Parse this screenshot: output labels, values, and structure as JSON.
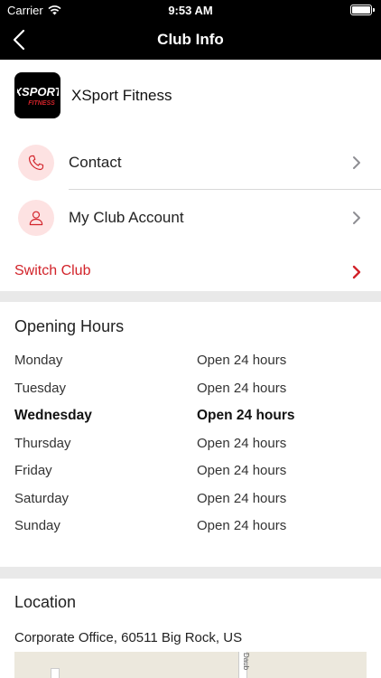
{
  "status": {
    "carrier": "Carrier",
    "time": "9:53 AM"
  },
  "nav": {
    "title": "Club Info"
  },
  "club": {
    "name": "XSport Fitness",
    "contact_label": "Contact",
    "account_label": "My Club Account",
    "switch_label": "Switch Club"
  },
  "hours": {
    "title": "Opening Hours",
    "rows": [
      {
        "day": "Monday",
        "value": "Open 24 hours"
      },
      {
        "day": "Tuesday",
        "value": "Open 24 hours"
      },
      {
        "day": "Wednesday",
        "value": "Open 24 hours"
      },
      {
        "day": "Thursday",
        "value": "Open 24 hours"
      },
      {
        "day": "Friday",
        "value": "Open 24 hours"
      },
      {
        "day": "Saturday",
        "value": "Open 24 hours"
      },
      {
        "day": "Sunday",
        "value": "Open 24 hours"
      }
    ]
  },
  "location": {
    "title": "Location",
    "address": "Corporate Office, 60511 Big Rock, US",
    "map_road_label": "Daub"
  },
  "colors": {
    "accent": "#d2232a",
    "icon_bg": "#fde2e2",
    "nav_bg": "#000000"
  },
  "icons": {
    "back": "chevron-left-icon",
    "contact": "phone-icon",
    "account": "user-icon",
    "row_chevron": "chevron-right-icon"
  }
}
